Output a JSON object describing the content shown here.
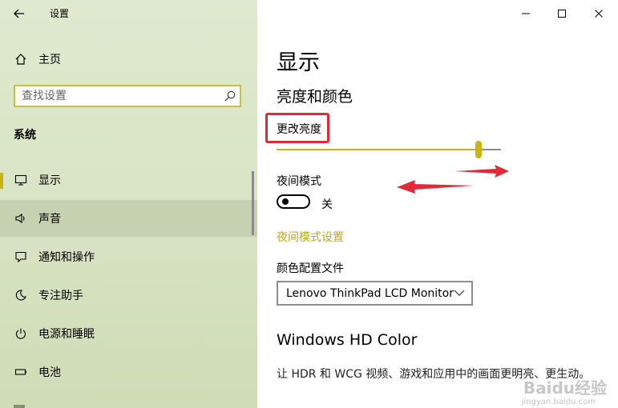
{
  "window": {
    "title": "设置"
  },
  "sidebar": {
    "home_label": "主页",
    "search_placeholder": "查找设置",
    "section_label": "系统",
    "items": [
      {
        "label": "显示",
        "icon": "monitor-icon"
      },
      {
        "label": "声音",
        "icon": "speaker-icon"
      },
      {
        "label": "通知和操作",
        "icon": "notification-icon"
      },
      {
        "label": "专注助手",
        "icon": "moon-icon"
      },
      {
        "label": "电源和睡眠",
        "icon": "power-icon"
      },
      {
        "label": "电池",
        "icon": "battery-icon"
      }
    ]
  },
  "main": {
    "page_title": "显示",
    "brightness_section_title": "亮度和颜色",
    "brightness_label": "更改亮度",
    "brightness_value": 0.9,
    "night_mode_label": "夜间模式",
    "night_mode_state": "关",
    "night_mode_link": "夜间模式设置",
    "color_profile_label": "颜色配置文件",
    "color_profile_value": "Lenovo ThinkPad LCD Monitor",
    "hd_color_title": "Windows HD Color",
    "hd_color_description": "让 HDR 和 WCG 视频、游戏和应用中的画面更明亮、更生动。"
  },
  "watermark": {
    "brand": "Baidu经验",
    "url": "jingyan.baidu.com"
  },
  "colors": {
    "accent": "#c8b414",
    "annotation_red": "#e02a3a",
    "sidebar_bg": "#dfe9cf"
  }
}
